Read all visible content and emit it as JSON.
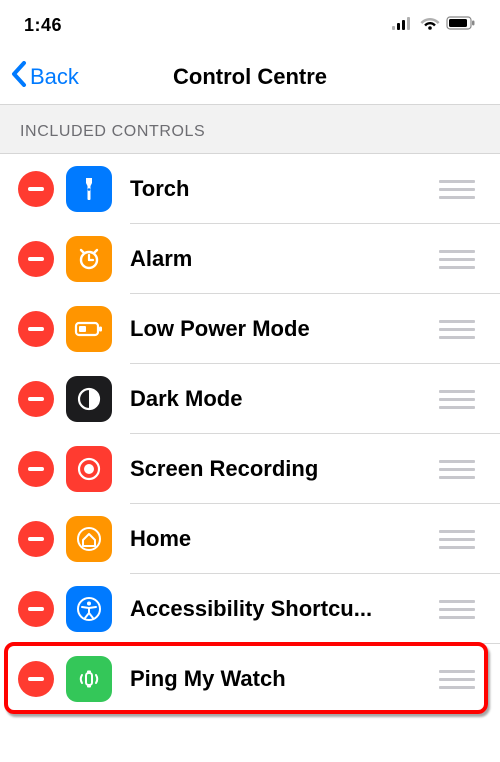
{
  "status": {
    "time": "1:46"
  },
  "nav": {
    "back": "Back",
    "title": "Control Centre"
  },
  "section": {
    "title": "INCLUDED CONTROLS"
  },
  "rows": [
    {
      "label": "Torch",
      "icon": "torch",
      "color": "ic-blue"
    },
    {
      "label": "Alarm",
      "icon": "alarm",
      "color": "ic-orange"
    },
    {
      "label": "Low Power Mode",
      "icon": "battery",
      "color": "ic-orange"
    },
    {
      "label": "Dark Mode",
      "icon": "darkmode",
      "color": "ic-dark"
    },
    {
      "label": "Screen Recording",
      "icon": "record",
      "color": "ic-red"
    },
    {
      "label": "Home",
      "icon": "home",
      "color": "ic-orange"
    },
    {
      "label": "Accessibility Shortcu...",
      "icon": "accessibility",
      "color": "ic-blue"
    },
    {
      "label": "Ping My Watch",
      "icon": "ping",
      "color": "ic-green"
    }
  ],
  "highlightIndex": 7
}
